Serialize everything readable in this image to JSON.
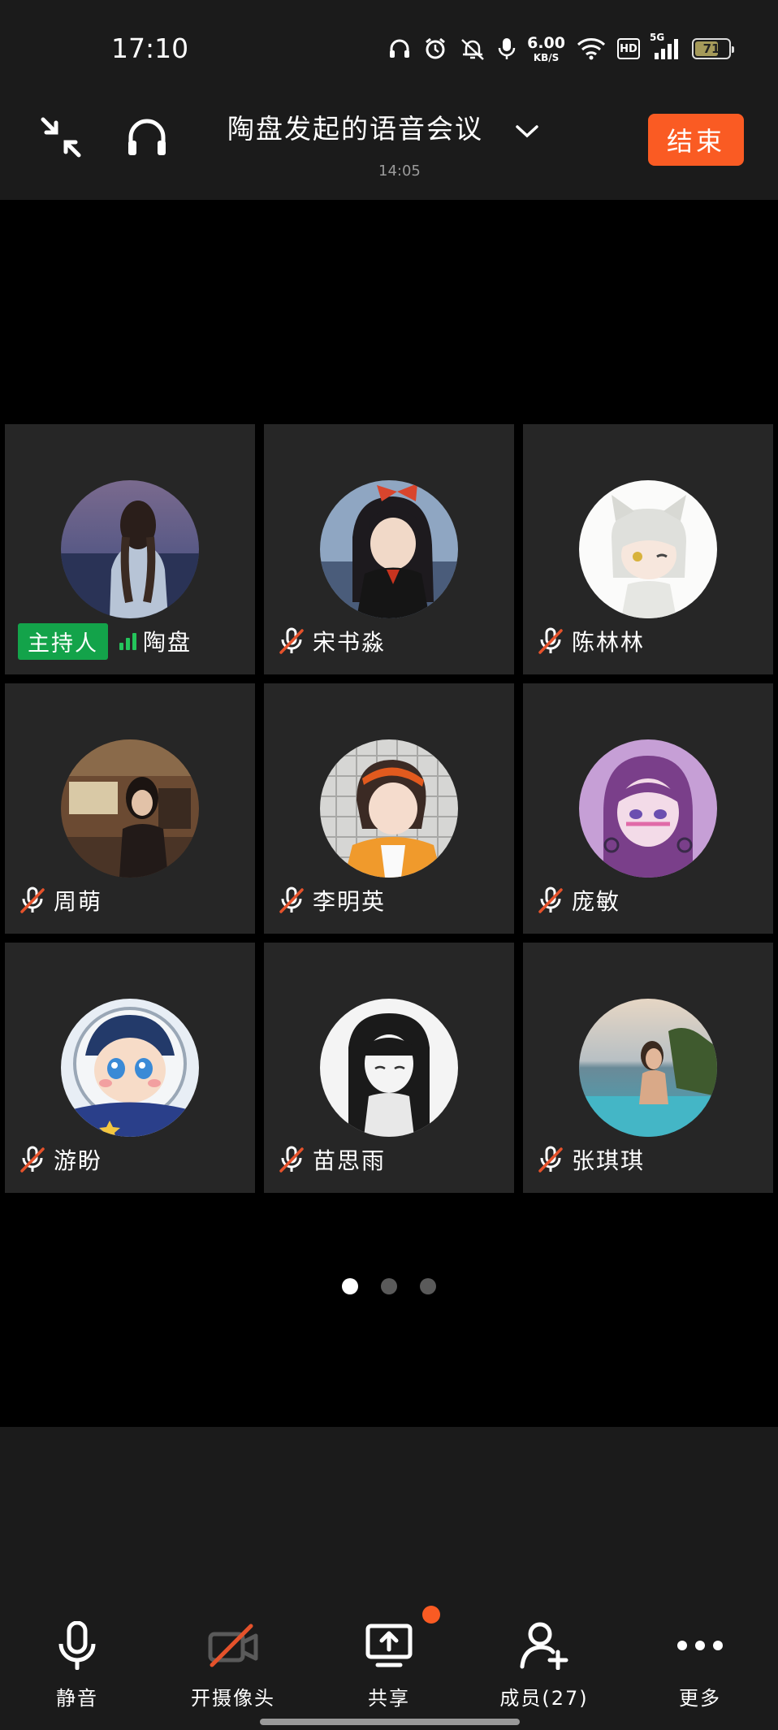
{
  "status_bar": {
    "time": "17:10",
    "net_speed_value": "6.00",
    "net_speed_unit": "KB/S",
    "hd_label": "HD",
    "network_label": "5G",
    "battery_level": "71",
    "battery_fraction": 0.71
  },
  "header": {
    "title": "陶盘发起的语音会议",
    "duration": "14:05",
    "end_button_label": "结束",
    "accent_color": "#fa5b23"
  },
  "participants": [
    {
      "name": "陶盘",
      "host_badge": "主持人",
      "muted": false,
      "avatar": "girl-braids-avatar"
    },
    {
      "name": "宋书淼",
      "muted": true,
      "avatar": "anime-girl-red-bow-avatar"
    },
    {
      "name": "陈林林",
      "muted": true,
      "avatar": "anime-cat-boy-avatar"
    },
    {
      "name": "周萌",
      "muted": true,
      "avatar": "girl-cafe-photo-avatar"
    },
    {
      "name": "李明英",
      "muted": true,
      "avatar": "girl-orange-headband-avatar"
    },
    {
      "name": "庞敏",
      "muted": true,
      "avatar": "anime-girl-purple-avatar"
    },
    {
      "name": "游盼",
      "muted": true,
      "avatar": "cartoon-astronaut-avatar"
    },
    {
      "name": "苗思雨",
      "muted": true,
      "avatar": "manga-girl-sketch-avatar"
    },
    {
      "name": "张琪琪",
      "muted": true,
      "avatar": "girl-pool-photo-avatar"
    }
  ],
  "pager": {
    "pages": 3,
    "current": 1
  },
  "toolbar": {
    "mute_label": "静音",
    "camera_label": "开摄像头",
    "share_label": "共享",
    "members_label": "成员(27)",
    "more_label": "更多"
  }
}
